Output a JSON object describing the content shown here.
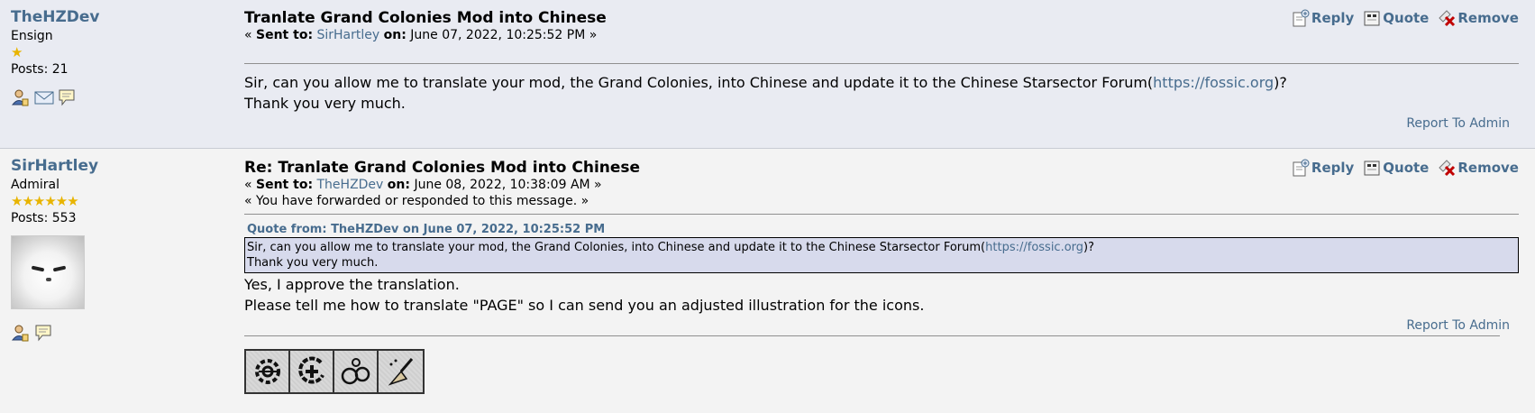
{
  "posts": [
    {
      "username": "TheHZDev",
      "rank": "Ensign",
      "stars": "★",
      "posts_count": "Posts: 21",
      "subject": "Tranlate Grand Colonies Mod into Chinese",
      "sent_prefix": "« ",
      "sent_label": "Sent to:",
      "sent_to": "SirHartley",
      "on_label": "on:",
      "date": "June 07, 2022, 10:25:52 PM »",
      "body_pre": "Sir, can you allow me to translate your mod, the Grand Colonies, into Chinese and update it to the Chinese Starsector Forum(",
      "body_link": "https://fossic.org",
      "body_post": ")?",
      "body_line2": "Thank you very much.",
      "report": "Report To Admin"
    },
    {
      "username": "SirHartley",
      "rank": "Admiral",
      "stars": "★★★★★★",
      "posts_count": "Posts: 553",
      "subject": "Re: Tranlate Grand Colonies Mod into Chinese",
      "sent_prefix": "« ",
      "sent_label": "Sent to:",
      "sent_to": "TheHZDev",
      "on_label": "on:",
      "date": "June 08, 2022, 10:38:09 AM »",
      "forwarded": "« You have forwarded or responded to this message. »",
      "quote_header": "Quote from: TheHZDev on June 07, 2022, 10:25:52 PM",
      "quote_pre": "Sir, can you allow me to translate your mod, the Grand Colonies, into Chinese and update it to the Chinese Starsector Forum(",
      "quote_link": "https://fossic.org",
      "quote_post": ")?",
      "quote_line2": "Thank you very much.",
      "body_line1": "Yes, I approve the translation.",
      "body_line2": "Please tell me how to translate \"PAGE\" so I can send you an adjusted illustration for the icons.",
      "report": "Report To Admin"
    }
  ],
  "actions": {
    "reply": "Reply",
    "quote": "Quote",
    "remove": "Remove"
  },
  "colors": {
    "link": "#476c8e",
    "post1_bg": "#e9ebf2",
    "post2_bg": "#f3f3f3",
    "quote_bg": "#d7daec",
    "star": "#e8b400"
  },
  "icons": [
    "profile-icon",
    "email-icon",
    "personal-message-icon",
    "reply-icon",
    "quote-icon",
    "remove-icon",
    "avatar-image",
    "signature-icons-image"
  ]
}
